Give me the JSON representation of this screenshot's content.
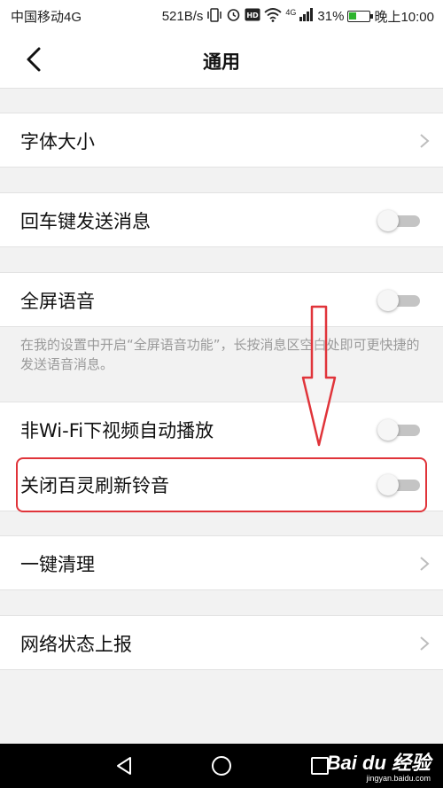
{
  "status_bar": {
    "carrier": "中国移动4G",
    "speed": "521B/s",
    "network": "4G",
    "battery_percent": "31%",
    "time": "晚上10:00"
  },
  "navbar": {
    "title": "通用"
  },
  "settings": {
    "font_size": "字体大小",
    "enter_send": "回车键发送消息",
    "fullscreen_voice": "全屏语音",
    "fullscreen_voice_hint": "在我的设置中开启“全屏语音功能”，长按消息区空白处即可更快捷的发送语音消息。",
    "autoplay_video": "非Wi-Fi下视频自动播放",
    "close_refresh_ringtone": "关闭百灵刷新铃音",
    "one_click_clean": "一键清理",
    "network_report": "网络状态上报"
  },
  "toggle_states": {
    "enter_send": false,
    "fullscreen_voice": false,
    "autoplay_video": false,
    "close_refresh_ringtone": false
  },
  "colors": {
    "highlight": "#e0343a",
    "toggle_off": "#c4c4c4",
    "battery": "#2db32d"
  },
  "watermark": {
    "logo": "Bai du 经验",
    "url": "jingyan.baidu.com"
  }
}
